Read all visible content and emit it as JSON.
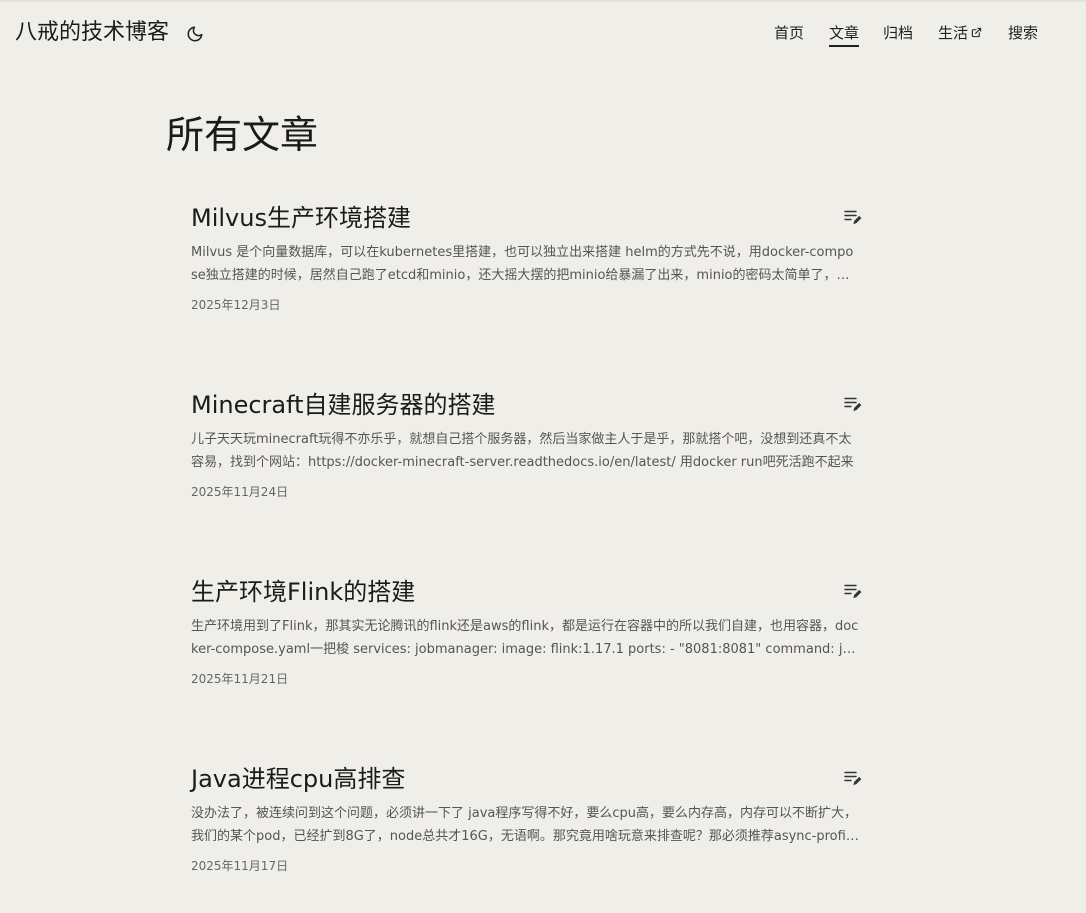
{
  "site": {
    "title": "八戒的技术博客",
    "theme_toggle_icon": "moon-icon"
  },
  "nav": {
    "items": [
      {
        "label": "首页",
        "active": false
      },
      {
        "label": "文章",
        "active": true
      },
      {
        "label": "归档",
        "active": false
      },
      {
        "label": "生活",
        "active": false,
        "icon": "external-link-icon"
      },
      {
        "label": "搜索",
        "active": false
      }
    ]
  },
  "page": {
    "title": "所有文章"
  },
  "posts": [
    {
      "title": "Milvus生产环境搭建",
      "summary": "Milvus 是个向量数据库，可以在kubernetes里搭建，也可以独立出来搭建 helm的方式先不说，用docker-compose独立搭建的时候，居然自己跑了etcd和minio，还大摇大摆的把minio给暴漏了出来，minio的密码太简单了，外网能直接访问",
      "date": "2025年12月3日",
      "icon": "edit-note-icon"
    },
    {
      "title": "Minecraft自建服务器的搭建",
      "summary": "儿子天天玩minecraft玩得不亦乐乎，就想自己搭个服务器，然后当家做主人于是乎，那就搭个吧，没想到还真不太容易，找到个网站：https://docker-minecraft-server.readthedocs.io/en/latest/ 用docker run吧死活跑不起来",
      "date": "2025年11月24日",
      "icon": "edit-note-icon"
    },
    {
      "title": "生产环境Flink的搭建",
      "summary": "生产环境用到了Flink，那其实无论腾讯的flink还是aws的flink，都是运行在容器中的所以我们自建，也用容器，docker-compose.yaml一把梭 services: jobmanager: image: flink:1.17.1 ports: - \"8081:8081\" command: jobmanager",
      "date": "2025年11月21日",
      "icon": "edit-note-icon"
    },
    {
      "title": "Java进程cpu高排查",
      "summary": "没办法了，被连续问到这个问题，必须讲一下了 java程序写得不好，要么cpu高，要么内存高，内存可以不断扩大，我们的某个pod，已经扩到8G了，node总共才16G，无语啊。那究竟用啥玩意来排查呢？那必须推荐async-profiler",
      "date": "2025年11月17日",
      "icon": "edit-note-icon"
    }
  ]
}
